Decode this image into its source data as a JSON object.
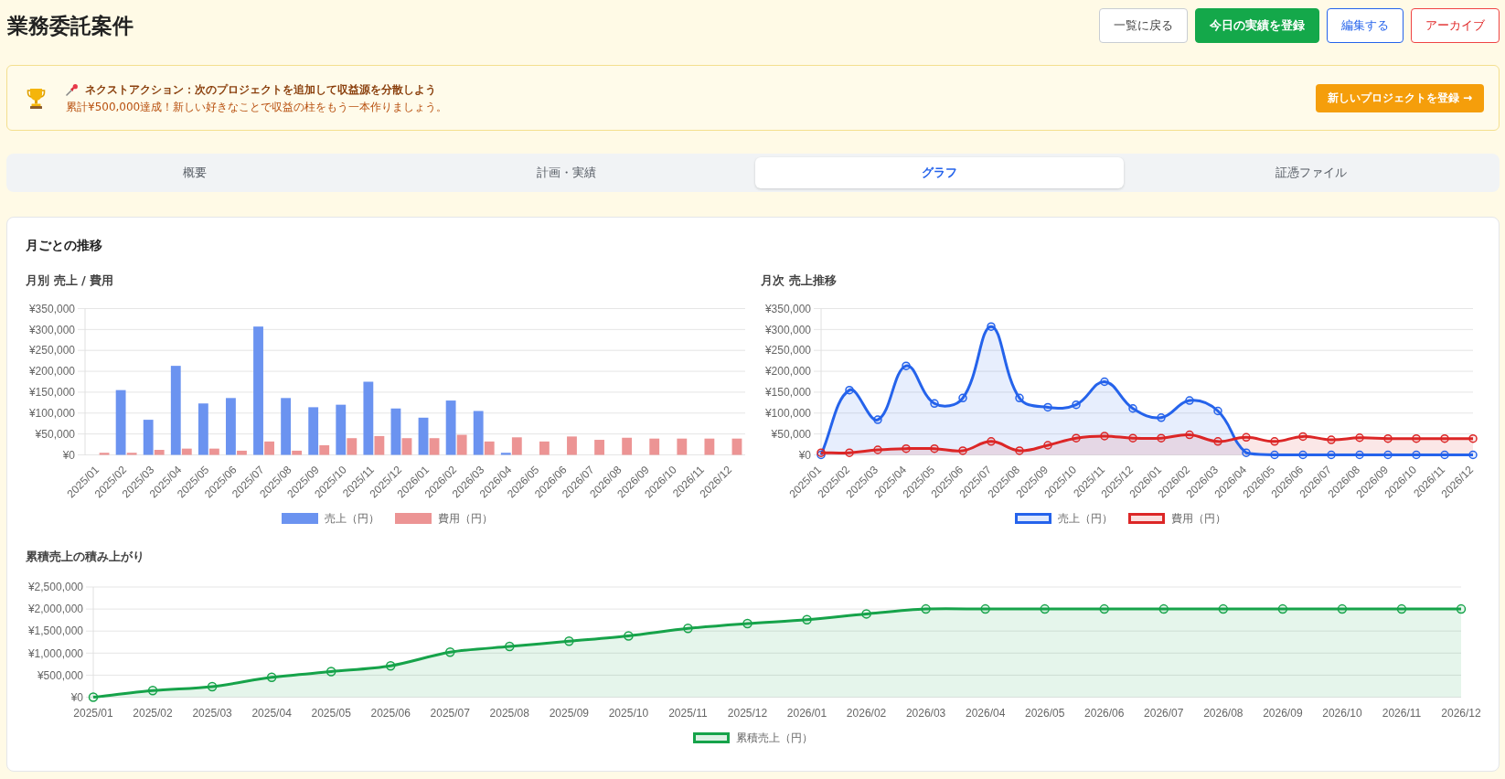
{
  "page": {
    "title": "業務委託案件"
  },
  "header_buttons": [
    {
      "label": "一覧に戻る",
      "kind": "secondary"
    },
    {
      "label": "今日の実績を登録",
      "kind": "success"
    },
    {
      "label": "編集する",
      "kind": "primary"
    },
    {
      "label": "アーカイブ",
      "kind": "danger"
    }
  ],
  "next_action": {
    "title": "ネクストアクション：次のプロジェクトを追加して収益源を分散しよう",
    "message": "累計¥500,000達成！新しい好きなことで収益の柱をもう一本作りましょう。",
    "button": "新しいプロジェクトを登録 →"
  },
  "tabs": [
    {
      "label": "概要",
      "selected": false
    },
    {
      "label": "計画・実績",
      "selected": false
    },
    {
      "label": "グラフ",
      "selected": true
    },
    {
      "label": "証憑ファイル",
      "selected": false
    }
  ],
  "graph_panel": {
    "title": "月ごとの推移",
    "charts": [
      {
        "chart_data": {
          "type": "bar",
          "title": "月別 売上 / 費用",
          "categories": [
            "2025/01",
            "2025/02",
            "2025/03",
            "2025/04",
            "2025/05",
            "2025/06",
            "2025/07",
            "2025/08",
            "2025/09",
            "2025/10",
            "2025/11",
            "2025/12",
            "2026/01",
            "2026/02",
            "2026/03",
            "2026/04",
            "2026/05",
            "2026/06",
            "2026/07",
            "2026/08",
            "2026/09",
            "2026/10",
            "2026/11",
            "2026/12"
          ],
          "series": [
            {
              "name": "売上（円）",
              "color": "#6b93f0",
              "values": [
                0,
                155000,
                84000,
                213000,
                123000,
                136000,
                307000,
                136000,
                114000,
                120000,
                175000,
                111000,
                89000,
                130000,
                105000,
                5000,
                0,
                0,
                0,
                0,
                0,
                0,
                0,
                0
              ]
            },
            {
              "name": "費用（円）",
              "color": "#ec9494",
              "values": [
                5000,
                5000,
                12000,
                15000,
                15000,
                10000,
                32000,
                10000,
                23000,
                40000,
                45000,
                40000,
                40000,
                48000,
                32000,
                42000,
                32000,
                44000,
                36000,
                41000,
                39000,
                39000,
                39000,
                39000
              ]
            }
          ],
          "ylim": [
            0,
            350000
          ],
          "yticks": [
            {
              "value": 0,
              "label": "¥0"
            },
            {
              "value": 50000,
              "label": "¥50,000"
            },
            {
              "value": 100000,
              "label": "¥100,000"
            },
            {
              "value": 150000,
              "label": "¥150,000"
            },
            {
              "value": 200000,
              "label": "¥200,000"
            },
            {
              "value": 250000,
              "label": "¥250,000"
            },
            {
              "value": 300000,
              "label": "¥300,000"
            },
            {
              "value": 350000,
              "label": "¥350,000"
            }
          ],
          "grid": true,
          "legend": "bottom"
        }
      },
      {
        "chart_data": {
          "type": "area",
          "title": "月次 売上推移",
          "categories": [
            "2025/01",
            "2025/02",
            "2025/03",
            "2025/04",
            "2025/05",
            "2025/06",
            "2025/07",
            "2025/08",
            "2025/09",
            "2025/10",
            "2025/11",
            "2025/12",
            "2026/01",
            "2026/02",
            "2026/03",
            "2026/04",
            "2026/05",
            "2026/06",
            "2026/07",
            "2026/08",
            "2026/09",
            "2026/10",
            "2026/11",
            "2026/12"
          ],
          "series": [
            {
              "name": "売上（円）",
              "color": "#2563eb",
              "values": [
                0,
                155000,
                84000,
                213000,
                123000,
                136000,
                307000,
                136000,
                114000,
                120000,
                175000,
                111000,
                89000,
                130000,
                105000,
                5000,
                0,
                0,
                0,
                0,
                0,
                0,
                0,
                0
              ]
            },
            {
              "name": "費用（円）",
              "color": "#dc2626",
              "values": [
                5000,
                5000,
                12000,
                15000,
                15000,
                10000,
                32000,
                10000,
                23000,
                40000,
                45000,
                40000,
                40000,
                48000,
                32000,
                42000,
                32000,
                44000,
                36000,
                41000,
                39000,
                39000,
                39000,
                39000
              ]
            }
          ],
          "ylim": [
            0,
            350000
          ],
          "yticks": [
            {
              "value": 0,
              "label": "¥0"
            },
            {
              "value": 50000,
              "label": "¥50,000"
            },
            {
              "value": 100000,
              "label": "¥100,000"
            },
            {
              "value": 150000,
              "label": "¥150,000"
            },
            {
              "value": 200000,
              "label": "¥200,000"
            },
            {
              "value": 250000,
              "label": "¥250,000"
            },
            {
              "value": 300000,
              "label": "¥300,000"
            },
            {
              "value": 350000,
              "label": "¥350,000"
            }
          ],
          "grid": true,
          "legend": "bottom"
        }
      },
      {
        "chart_data": {
          "type": "area",
          "title": "累積売上の積み上がり",
          "categories": [
            "2025/01",
            "2025/02",
            "2025/03",
            "2025/04",
            "2025/05",
            "2025/06",
            "2025/07",
            "2025/08",
            "2025/09",
            "2025/10",
            "2025/11",
            "2025/12",
            "2026/01",
            "2026/02",
            "2026/03",
            "2026/04",
            "2026/05",
            "2026/06",
            "2026/07",
            "2026/08",
            "2026/09",
            "2026/10",
            "2026/11",
            "2026/12"
          ],
          "series": [
            {
              "name": "累積売上（円）",
              "color": "#16a34a",
              "values": [
                0,
                150000,
                240000,
                450000,
                580000,
                710000,
                1020000,
                1150000,
                1270000,
                1390000,
                1560000,
                1670000,
                1760000,
                1890000,
                2000000,
                2000000,
                2000000,
                2000000,
                2000000,
                2000000,
                2000000,
                2000000,
                2000000,
                2000000
              ]
            }
          ],
          "ylim": [
            0,
            2500000
          ],
          "yticks": [
            {
              "value": 0,
              "label": "¥0"
            },
            {
              "value": 500000,
              "label": "¥500,000"
            },
            {
              "value": 1000000,
              "label": "¥1,000,000"
            },
            {
              "value": 1500000,
              "label": "¥1,500,000"
            },
            {
              "value": 2000000,
              "label": "¥2,000,000"
            },
            {
              "value": 2500000,
              "label": "¥2,500,000"
            }
          ],
          "grid": true,
          "legend": "bottom"
        }
      }
    ]
  }
}
